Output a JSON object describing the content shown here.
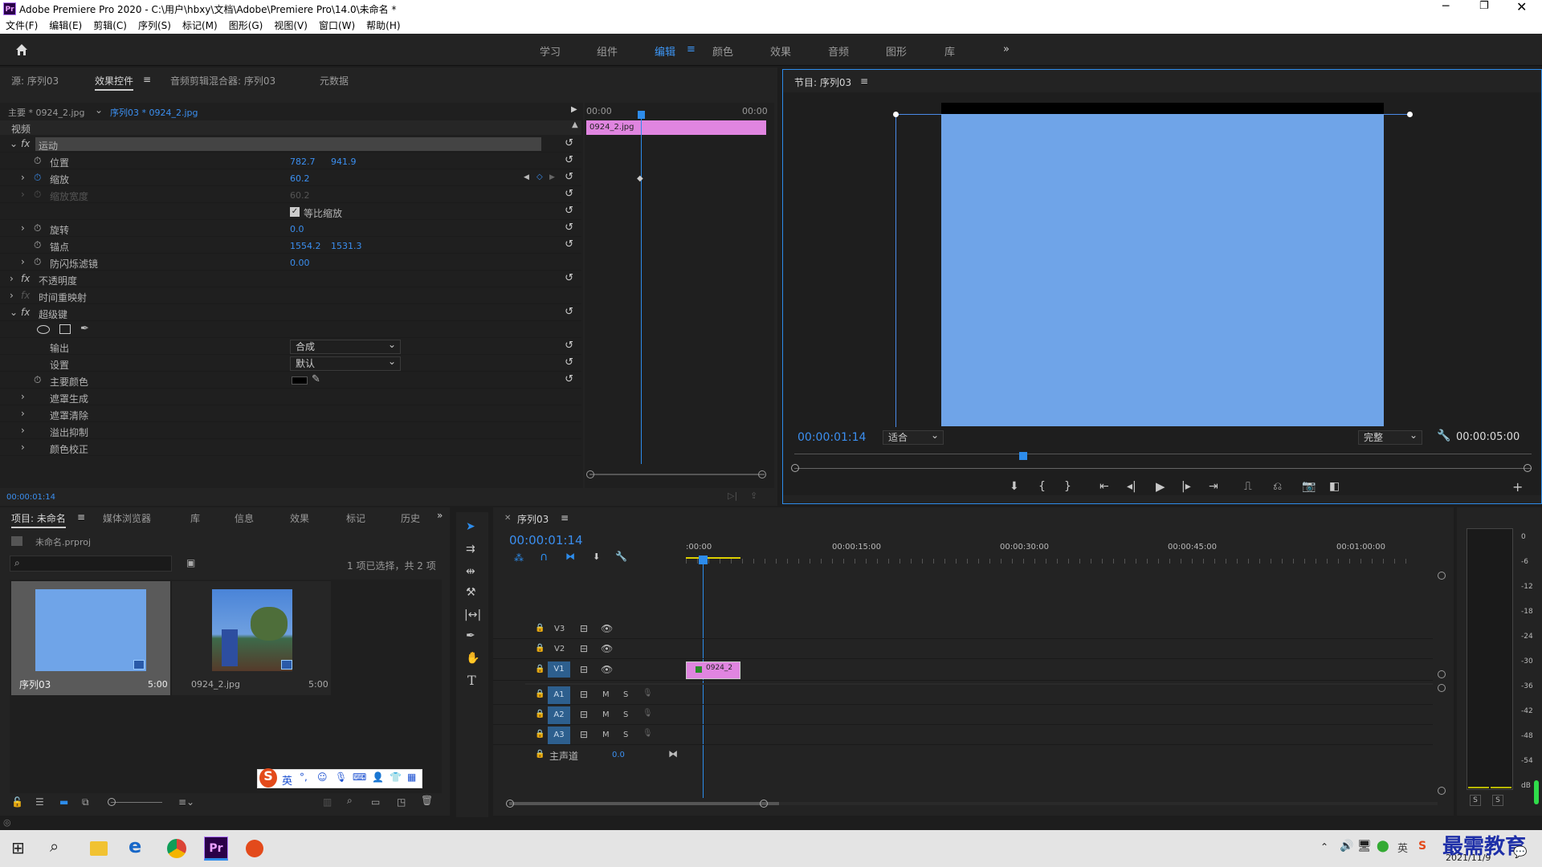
{
  "window": {
    "title": "Adobe Premiere Pro 2020 - C:\\用户\\hbxy\\文档\\Adobe\\Premiere Pro\\14.0\\未命名 *",
    "app_icon": "Pr"
  },
  "menu": [
    "文件(F)",
    "编辑(E)",
    "剪辑(C)",
    "序列(S)",
    "标记(M)",
    "图形(G)",
    "视图(V)",
    "窗口(W)",
    "帮助(H)"
  ],
  "workspaces": [
    "学习",
    "组件",
    "编辑",
    "颜色",
    "效果",
    "音频",
    "图形",
    "库"
  ],
  "active_workspace": "编辑",
  "left_tabs": [
    "源: 序列03",
    "效果控件",
    "音频剪辑混合器: 序列03",
    "元数据"
  ],
  "effect_controls": {
    "master": "主要 * 0924_2.jpg",
    "sequence_clip": "序列03 * 0924_2.jpg",
    "section": "视频",
    "motion": "运动",
    "position": "位置",
    "position_x": "782.7",
    "position_y": "941.9",
    "scale": "缩放",
    "scale_val": "60.2",
    "scale_width": "缩放宽度",
    "scale_width_val": "60.2",
    "uniform": "等比缩放",
    "rotation": "旋转",
    "rotation_val": "0.0",
    "anchor": "锚点",
    "anchor_x": "1554.2",
    "anchor_y": "1531.3",
    "flicker": "防闪烁滤镜",
    "flicker_val": "0.00",
    "opacity": "不透明度",
    "time_remap": "时间重映射",
    "ultrakey": "超级键",
    "output": "输出",
    "output_val": "合成",
    "setting": "设置",
    "setting_val": "默认",
    "key_color": "主要颜色",
    "matte_gen": "遮罩生成",
    "matte_clean": "遮罩清除",
    "spill": "溢出抑制",
    "color_correct": "颜色校正",
    "time_start": "00:00",
    "time_end": "00:00",
    "clip_name": "0924_2.jpg",
    "timecode": "00:00:01:14"
  },
  "program": {
    "title": "节目: 序列03",
    "timecode": "00:00:01:14",
    "fit": "适合",
    "quality": "完整",
    "duration": "00:00:05:00"
  },
  "project": {
    "tabs": [
      "项目: 未命名",
      "媒体浏览器",
      "库",
      "信息",
      "效果",
      "标记",
      "历史"
    ],
    "file": "未命名.prproj",
    "count": "1 项已选择，共 2 项",
    "items": [
      {
        "name": "序列03",
        "dur": "5:00"
      },
      {
        "name": "0924_2.jpg",
        "dur": "5:00"
      }
    ]
  },
  "ime": {
    "label": "英"
  },
  "timeline": {
    "tab": "序列03",
    "timecode": "00:00:01:14",
    "ruler": [
      ":00:00",
      "00:00:15:00",
      "00:00:30:00",
      "00:00:45:00",
      "00:01:00:00"
    ],
    "video_tracks": [
      "V3",
      "V2",
      "V1"
    ],
    "audio_tracks": [
      "A1",
      "A2",
      "A3"
    ],
    "master": "主声道",
    "master_val": "0.0",
    "clip": "0924_2",
    "m": "M",
    "s": "S"
  },
  "meter": {
    "ticks": [
      "0",
      "-6",
      "-12",
      "-18",
      "-24",
      "-30",
      "-36",
      "-42",
      "-48",
      "-54",
      "dB"
    ],
    "solo": "S"
  },
  "taskbar": {
    "date": "2021/11/9",
    "watermark": "最需教育"
  },
  "colors": {
    "accent": "#2d8ceb",
    "clip_pink": "#e085e0",
    "frame_blue": "#6fa4e8"
  }
}
